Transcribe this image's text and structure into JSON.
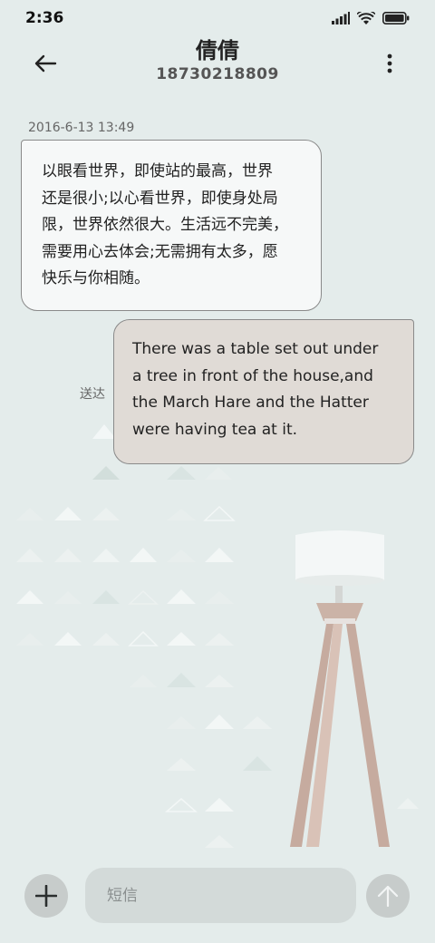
{
  "status_bar": {
    "time": "2:36",
    "icons": [
      "signal-icon",
      "wifi-icon",
      "battery-icon"
    ]
  },
  "header": {
    "contact_name": "倩倩",
    "contact_number": "18730218809",
    "back_icon": "arrow-left-icon",
    "more_icon": "vertical-dots-icon"
  },
  "conversation": {
    "timestamp": "2016-6-13 13:49",
    "messages": [
      {
        "direction": "incoming",
        "lines": [
          "以眼看世界，即使站的最高，世界",
          "还是很小;以心看世界，即使身处局",
          "限，世界依然很大。生活远不完美，",
          "需要用心去体会;无需拥有太多，愿",
          "快乐与你相随。"
        ]
      },
      {
        "direction": "outgoing",
        "status": "送达",
        "lines": [
          "There was a table set out under",
          "a tree in front of the house,and",
          "the March Hare and the Hatter",
          "were having tea at it."
        ]
      }
    ]
  },
  "composer": {
    "placeholder": "短信",
    "value": "",
    "attach_icon": "plus-icon",
    "send_icon": "arrow-up-icon"
  },
  "colors": {
    "background": "#e4eceb",
    "incoming_bubble": "#f6f8f8",
    "outgoing_bubble": "#e0dbd6",
    "button_bg": "#c7cccb",
    "input_bg": "#d3dad9"
  }
}
